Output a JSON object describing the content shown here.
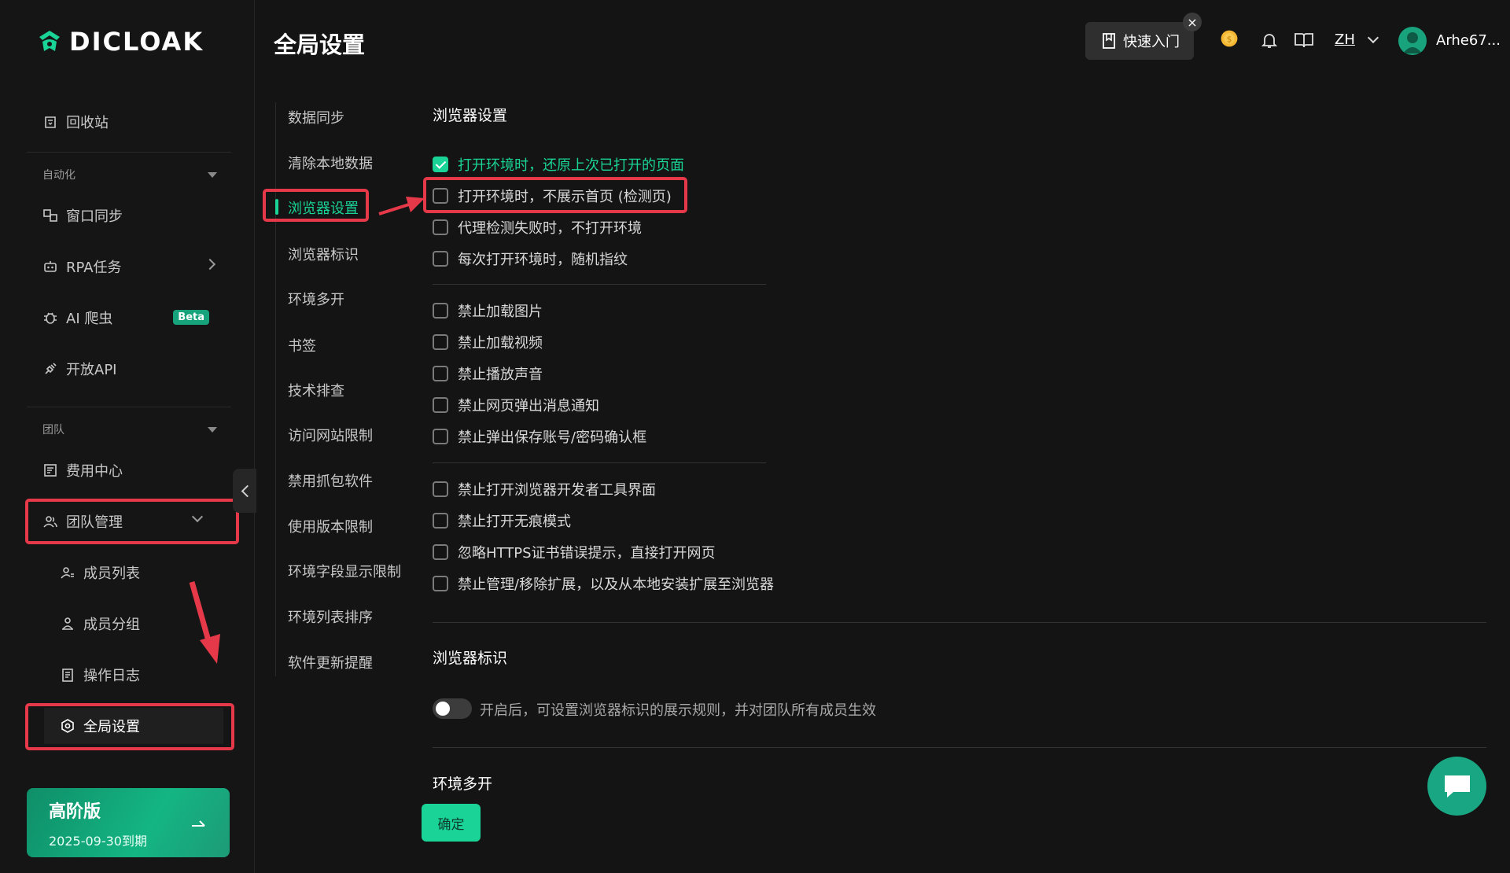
{
  "brand": {
    "name": "DICLOAK"
  },
  "page_title": "全局设置",
  "sidebar": {
    "recycle": "回收站",
    "group_automation": "自动化",
    "window_sync": "窗口同步",
    "rpa": "RPA任务",
    "ai_crawler": "AI 爬虫",
    "beta": "Beta",
    "open_api": "开放API",
    "group_team": "团队",
    "billing": "费用中心",
    "team_mgmt": "团队管理",
    "members": "成员列表",
    "member_groups": "成员分组",
    "op_logs": "操作日志",
    "global_settings": "全局设置"
  },
  "plan": {
    "title": "高阶版",
    "expiry": "2025-09-30到期"
  },
  "topbar": {
    "quick_start": "快速入门",
    "close": "×",
    "lang": "ZH",
    "user": "Arhe67..."
  },
  "subnav": [
    "数据同步",
    "清除本地数据",
    "浏览器设置",
    "浏览器标识",
    "环境多开",
    "书签",
    "技术排查",
    "访问网站限制",
    "禁用抓包软件",
    "使用版本限制",
    "环境字段显示限制",
    "环境列表排序",
    "软件更新提醒"
  ],
  "browser_settings": {
    "title": "浏览器设置",
    "options": [
      {
        "label": "打开环境时，还原上次已打开的页面",
        "checked": true
      },
      {
        "label": "打开环境时，不展示首页 (检测页)",
        "checked": false
      },
      {
        "label": "代理检测失败时，不打开环境",
        "checked": false
      },
      {
        "label": "每次打开环境时，随机指纹",
        "checked": false
      },
      {
        "label": "禁止加载图片",
        "checked": false
      },
      {
        "label": "禁止加载视频",
        "checked": false
      },
      {
        "label": "禁止播放声音",
        "checked": false
      },
      {
        "label": "禁止网页弹出消息通知",
        "checked": false
      },
      {
        "label": "禁止弹出保存账号/密码确认框",
        "checked": false
      },
      {
        "label": "禁止打开浏览器开发者工具界面",
        "checked": false
      },
      {
        "label": "禁止打开无痕模式",
        "checked": false
      },
      {
        "label": "忽略HTTPS证书错误提示，直接打开网页",
        "checked": false
      },
      {
        "label": "禁止管理/移除扩展，以及从本地安装扩展至浏览器",
        "checked": false
      }
    ]
  },
  "browser_identity": {
    "title": "浏览器标识",
    "toggle_on": false,
    "toggle_desc": "开启后，可设置浏览器标识的展示规则，并对团队所有成员生效"
  },
  "multi_env": {
    "title": "环境多开"
  },
  "confirm": "确定",
  "colors": {
    "accent": "#19d496",
    "highlight": "#e5394a",
    "background": "#141414"
  }
}
